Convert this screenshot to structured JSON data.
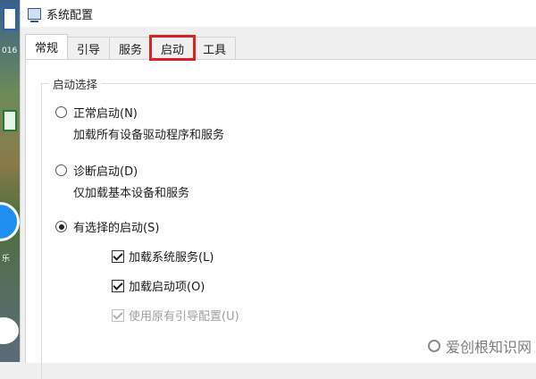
{
  "desktop": {
    "caption_1": "016",
    "caption_2": "乐"
  },
  "window": {
    "title": "系统配置"
  },
  "tabs": [
    {
      "label": "常规",
      "active": true
    },
    {
      "label": "引导",
      "active": false
    },
    {
      "label": "服务",
      "active": false
    },
    {
      "label": "启动",
      "active": false,
      "highlighted": true
    },
    {
      "label": "工具",
      "active": false
    }
  ],
  "startup_selection": {
    "legend": "启动选择",
    "options": [
      {
        "label": "正常启动(N)",
        "description": "加载所有设备驱动程序和服务",
        "selected": false
      },
      {
        "label": "诊断启动(D)",
        "description": "仅加载基本设备和服务",
        "selected": false
      },
      {
        "label": "有选择的启动(S)",
        "selected": true
      }
    ],
    "checkboxes": [
      {
        "label": "加载系统服务(L)",
        "checked": true,
        "disabled": false
      },
      {
        "label": "加载启动项(O)",
        "checked": true,
        "disabled": false
      },
      {
        "label": "使用原有引导配置(U)",
        "checked": true,
        "disabled": true
      }
    ]
  },
  "watermark": {
    "text": "爱创根知识网"
  },
  "colors": {
    "highlight": "#e31e24"
  }
}
